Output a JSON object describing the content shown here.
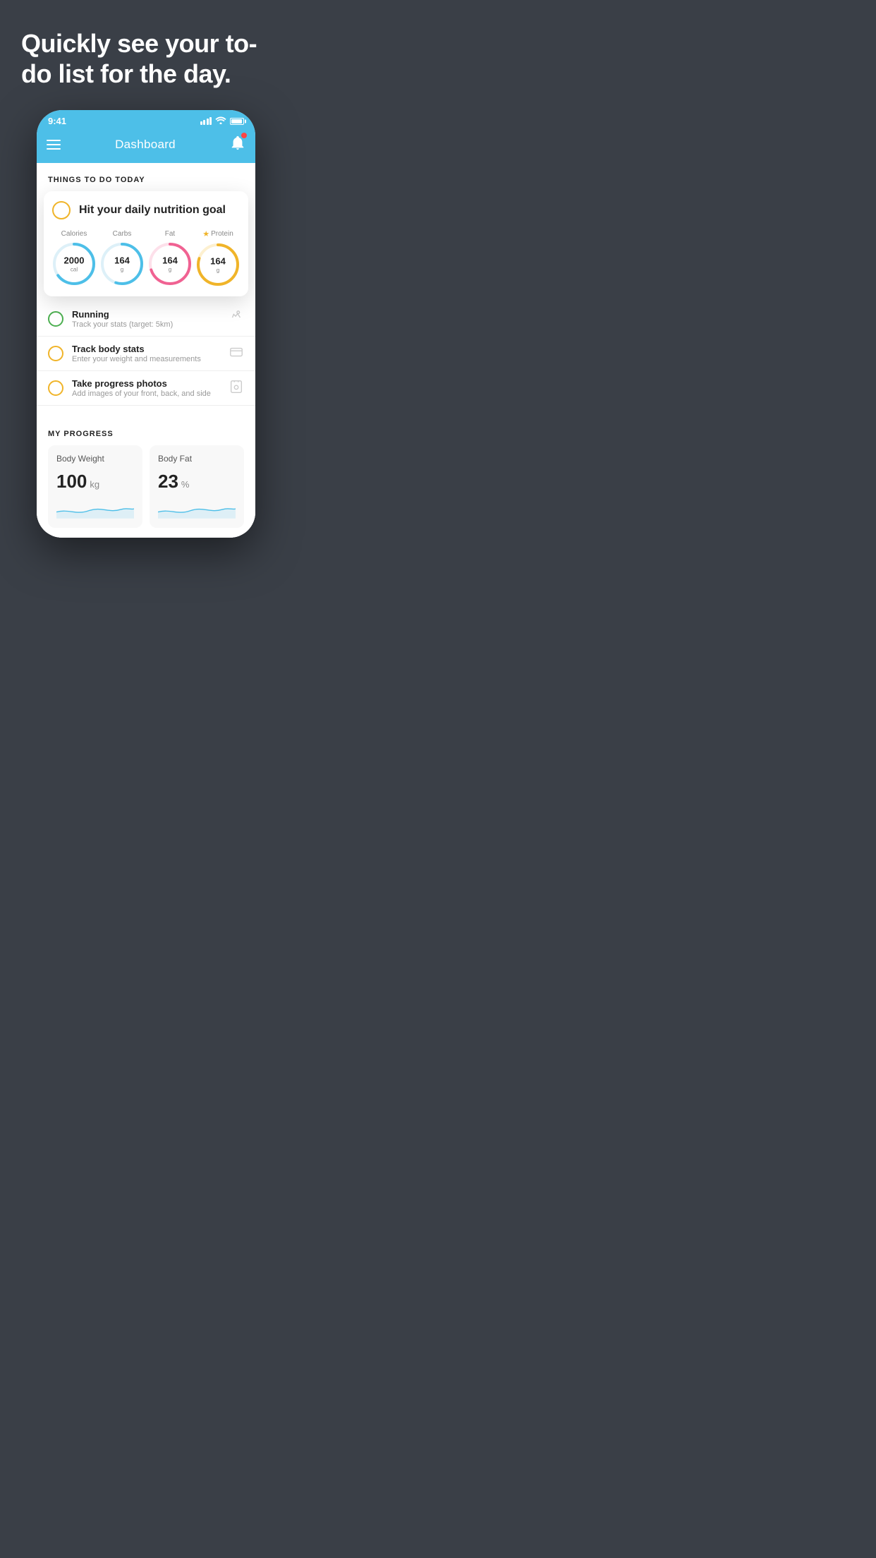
{
  "hero": {
    "title": "Quickly see your to-do list for the day."
  },
  "status_bar": {
    "time": "9:41"
  },
  "app_header": {
    "title": "Dashboard"
  },
  "things_section": {
    "label": "THINGS TO DO TODAY"
  },
  "nutrition_card": {
    "title": "Hit your daily nutrition goal",
    "stats": [
      {
        "label": "Calories",
        "value": "2000",
        "unit": "cal",
        "color": "#4dbfe8",
        "trail": "#ddf0f8",
        "pct": 65
      },
      {
        "label": "Carbs",
        "value": "164",
        "unit": "g",
        "color": "#4dbfe8",
        "trail": "#ddf0f8",
        "pct": 55
      },
      {
        "label": "Fat",
        "value": "164",
        "unit": "g",
        "color": "#f06292",
        "trail": "#fde0ea",
        "pct": 70
      },
      {
        "label": "Protein",
        "value": "164",
        "unit": "g",
        "color": "#f0b429",
        "trail": "#fdf0d0",
        "pct": 80,
        "star": true
      }
    ]
  },
  "todo_items": [
    {
      "title": "Running",
      "sub": "Track your stats (target: 5km)",
      "circle": "green",
      "icon": "👟"
    },
    {
      "title": "Track body stats",
      "sub": "Enter your weight and measurements",
      "circle": "yellow",
      "icon": "⚖️"
    },
    {
      "title": "Take progress photos",
      "sub": "Add images of your front, back, and side",
      "circle": "yellow",
      "icon": "👤"
    }
  ],
  "progress_section": {
    "label": "MY PROGRESS",
    "cards": [
      {
        "title": "Body Weight",
        "value": "100",
        "unit": "kg"
      },
      {
        "title": "Body Fat",
        "value": "23",
        "unit": "%"
      }
    ]
  }
}
